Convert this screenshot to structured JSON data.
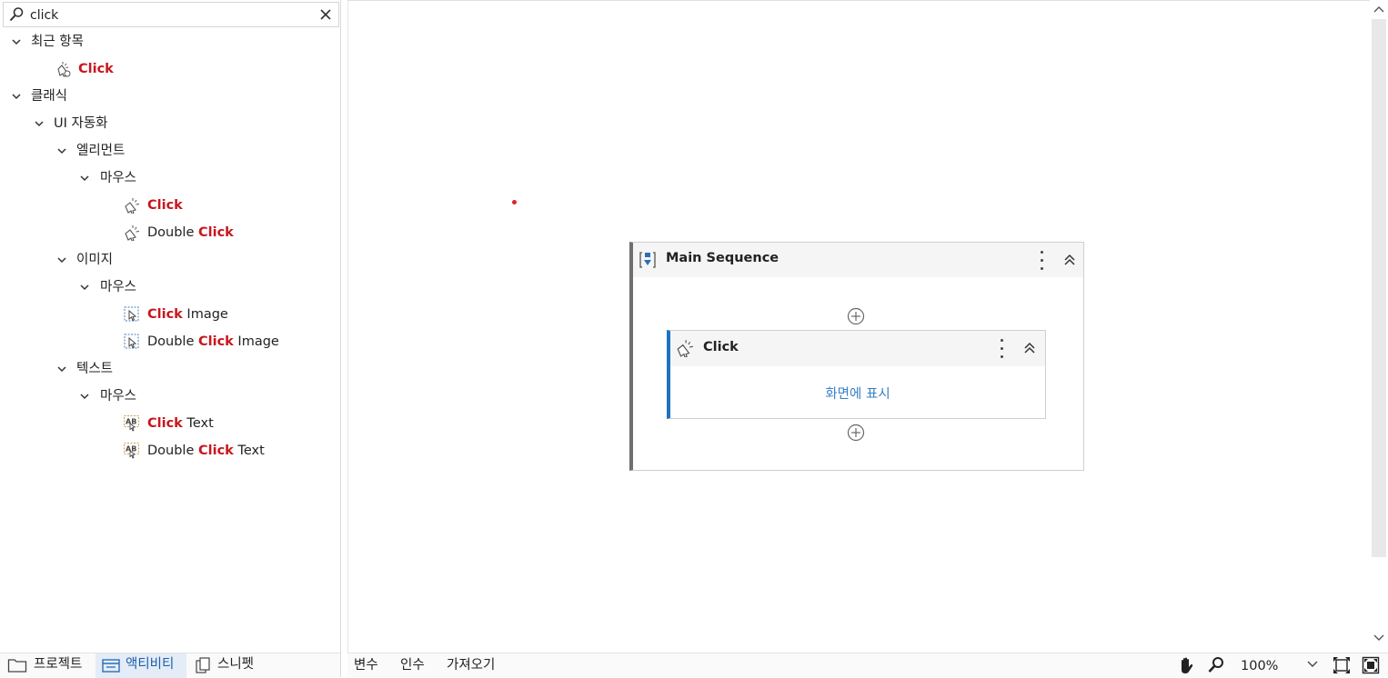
{
  "search": {
    "value": "click",
    "placeholder": ""
  },
  "tree": {
    "recent": {
      "label": "최근 항목",
      "items": [
        {
          "hl": "Click",
          "rest": ""
        }
      ]
    },
    "classic": {
      "label": "클래식",
      "ui_automation": {
        "label": "UI 자동화",
        "element": {
          "label": "엘리먼트",
          "mouse": {
            "label": "마우스",
            "items": [
              {
                "pre": "",
                "hl": "Click",
                "rest": ""
              },
              {
                "pre": "Double ",
                "hl": "Click",
                "rest": ""
              }
            ]
          }
        },
        "image": {
          "label": "이미지",
          "mouse": {
            "label": "마우스",
            "items": [
              {
                "pre": "",
                "hl": "Click",
                "rest": " Image"
              },
              {
                "pre": "Double ",
                "hl": "Click",
                "rest": " Image"
              }
            ]
          }
        },
        "text": {
          "label": "텍스트",
          "mouse": {
            "label": "마우스",
            "items": [
              {
                "pre": "",
                "hl": "Click",
                "rest": " Text"
              },
              {
                "pre": "Double ",
                "hl": "Click",
                "rest": " Text"
              }
            ]
          }
        }
      }
    }
  },
  "left_tabs": [
    {
      "label": "프로젝트",
      "icon": "folder-icon",
      "active": false
    },
    {
      "label": "액티비티",
      "icon": "activities-icon",
      "active": true
    },
    {
      "label": "스니펫",
      "icon": "snippets-icon",
      "active": false
    }
  ],
  "designer": {
    "sequence": {
      "title": "Main Sequence",
      "icon": "sequence-icon"
    },
    "activity": {
      "title": "Click",
      "link": "화면에 표시",
      "icon": "click-icon"
    }
  },
  "bottom": {
    "tabs": [
      "변수",
      "인수",
      "가져오기"
    ],
    "zoom": "100%",
    "icons": [
      "hand-pan-icon",
      "zoom-search-icon",
      "chevron-down-icon",
      "fit-to-screen-icon",
      "overview-icon"
    ]
  },
  "colors": {
    "highlight": "#c8161d",
    "accent": "#1b73c2",
    "link": "#3a7fc8"
  }
}
